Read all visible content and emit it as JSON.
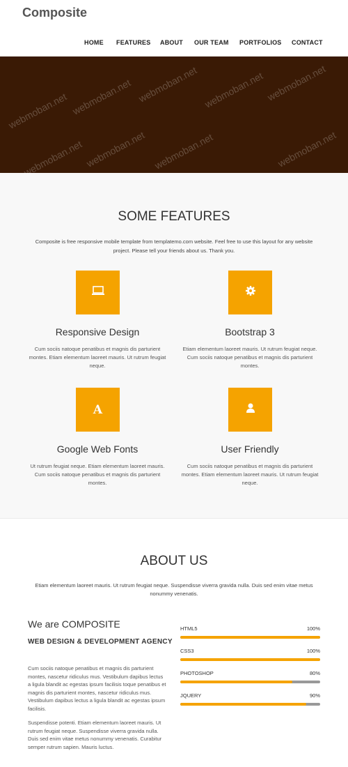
{
  "header": {
    "logo": "Composite",
    "nav": [
      "HOME",
      "FEATURES",
      "ABOUT",
      "OUR TEAM",
      "PORTFOLIOS",
      "CONTACT"
    ]
  },
  "hero": {
    "watermark": "webmoban.net",
    "background_color": "#3a1a05"
  },
  "features": {
    "title": "SOME FEATURES",
    "description": "Composite is free responsive mobile template from templatemo.com website. Feel free to use this layout for any website project. Please tell your friends about us. Thank you.",
    "items": [
      {
        "icon": "laptop-icon",
        "title": "Responsive Design",
        "text": "Cum sociis natoque penatibus et magnis dis parturient montes. Etiam elementum laoreet mauris. Ut rutrum feugiat neque."
      },
      {
        "icon": "gear-icon",
        "title": "Bootstrap 3",
        "text": "Etiam elementum laoreet mauris. Ut rutrum feugiat neque. Cum sociis natoque penatibus et magnis dis parturient montes."
      },
      {
        "icon": "font-icon",
        "title": "Google Web Fonts",
        "text": "Ut rutrum feugiat neque. Etiam elementum laoreet mauris. Cum sociis natoque penatibus et magnis dis parturient montes."
      },
      {
        "icon": "user-icon",
        "title": "User Friendly",
        "text": "Cum sociis natoque penatibus et magnis dis parturient montes. Etiam elementum laoreet mauris. Ut rutrum feugiat neque."
      }
    ],
    "accent_color": "#f5a300"
  },
  "about": {
    "title": "ABOUT US",
    "description": "Etiam elementum laoreet mauris. Ut rutrum feugiat neque. Suspendisse viverra gravida nulla. Duis sed enim vitae metus nonummy venenatis.",
    "we_are": "We are COMPOSITE",
    "agency": "WEB DESIGN & DEVELOPMENT AGENCY",
    "paragraph1": "Cum sociis natoque penatibus et magnis dis parturient montes, nascetur ridiculus mus. Vestibulum dapibus lectus a ligula blandit ac egestas ipsum facilisis toque penatibus et magnis dis parturient montes, nascetur ridiculus mus. Vestibulum dapibus lectus a ligula blandit ac egestas ipsum facilisis.",
    "paragraph2": "Suspendisse potenti. Etiam elementum laoreet mauris. Ut rutrum feugiat neque. Suspendisse viverra gravida nulla. Duis sed enim vitae metus nonummy venenatis. Curabitur semper rutrum sapien. Mauris luctus.",
    "skills": [
      {
        "name": "HTML5",
        "percent_label": "100%",
        "level": 1.0
      },
      {
        "name": "CSS3",
        "percent_label": "100%",
        "level": 1.0
      },
      {
        "name": "PHOTOSHOP",
        "percent_label": "80%",
        "level": 0.8
      },
      {
        "name": "JQUERY",
        "percent_label": "90%",
        "level": 0.9
      }
    ]
  }
}
